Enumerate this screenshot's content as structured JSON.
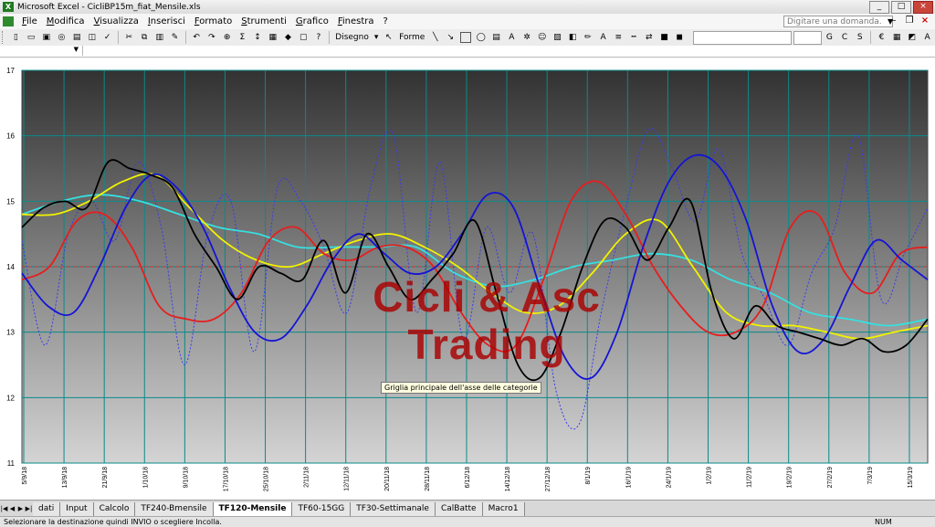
{
  "window": {
    "title": "Microsoft Excel - CicliBP15m_fiat_Mensile.xls"
  },
  "menu": [
    "File",
    "Modifica",
    "Visualizza",
    "Inserisci",
    "Formato",
    "Strumenti",
    "Grafico",
    "Finestra",
    "?"
  ],
  "help_box": {
    "placeholder": "Digitare una domanda."
  },
  "toolbar": {
    "drawing_label": "Disegno",
    "shapes_label": "Forme"
  },
  "watermark": {
    "line1": "Cicli & Asc",
    "line2": "Trading"
  },
  "tooltip": "Griglia principale dell'asse delle categorie",
  "sheet_tabs": [
    "dati",
    "Input",
    "Calcolo",
    "TF240-Bmensile",
    "TF120-Mensile",
    "TF60-15GG",
    "TF30-Settimanale",
    "CalBatte",
    "Macro1"
  ],
  "active_tab": "TF120-Mensile",
  "status": {
    "message": "Selezionare la destinazione quindi INVIO o scegliere Incolla.",
    "num": "NUM"
  },
  "colors": {
    "black": "#000000",
    "blue": "#1414d6",
    "red": "#e61e1e",
    "yellow": "#f2f200",
    "cyan": "#36e0e0",
    "dotted": "#3a3aee",
    "refline": "#d03030",
    "grid": "#0a8a8a"
  },
  "chart_data": {
    "type": "line",
    "ylim": [
      11,
      17
    ],
    "yticks": [
      11,
      12,
      13,
      14,
      15,
      16,
      17
    ],
    "reference_line": 14,
    "grid": true,
    "xticks": [
      "5/9/18",
      "13/9/18",
      "21/9/18",
      "1/10/18",
      "9/10/18",
      "17/10/18",
      "25/10/18",
      "2/11/18",
      "12/11/18",
      "20/11/18",
      "28/11/18",
      "6/12/18",
      "14/12/18",
      "27/12/18",
      "8/1/19",
      "16/1/19",
      "24/1/19",
      "1/2/19",
      "11/2/19",
      "19/2/19",
      "27/2/19",
      "7/3/19",
      "15/3/19"
    ],
    "series": [
      {
        "color": "#000000",
        "style": "solid",
        "values": [
          14.6,
          14.9,
          15.0,
          14.9,
          15.6,
          15.5,
          15.4,
          15.2,
          14.5,
          14.0,
          13.5,
          14.0,
          13.9,
          13.8,
          14.4,
          13.6,
          14.5,
          14.0,
          13.5,
          13.8,
          14.2,
          14.7,
          13.6,
          12.5,
          12.3,
          13.0,
          14.0,
          14.7,
          14.6,
          14.1,
          14.6,
          15.0,
          13.6,
          12.9,
          13.4,
          13.1,
          13.0,
          12.9,
          12.8,
          12.9,
          12.7,
          12.8,
          13.2
        ]
      },
      {
        "color": "#1414d6",
        "style": "solid",
        "values": [
          13.9,
          13.4,
          13.3,
          14.0,
          14.9,
          15.4,
          15.2,
          14.6,
          13.7,
          13.0,
          12.9,
          13.4,
          14.1,
          14.5,
          14.2,
          13.9,
          14.0,
          14.5,
          15.1,
          14.9,
          13.7,
          12.6,
          12.3,
          13.0,
          14.3,
          15.3,
          15.7,
          15.5,
          14.7,
          13.4,
          12.7,
          12.9,
          13.7,
          14.4,
          14.1,
          13.8
        ]
      },
      {
        "color": "#e61e1e",
        "style": "solid",
        "values": [
          13.8,
          14.0,
          14.7,
          14.8,
          14.3,
          13.4,
          13.2,
          13.2,
          13.6,
          14.4,
          14.6,
          14.2,
          14.1,
          14.3,
          14.3,
          14.0,
          13.3,
          12.8,
          12.8,
          13.8,
          15.0,
          15.3,
          14.8,
          14.0,
          13.4,
          13.0,
          13.0,
          13.4,
          14.6,
          14.8,
          13.9,
          13.6,
          14.2,
          14.3
        ]
      },
      {
        "color": "#f2f200",
        "style": "solid",
        "values": [
          14.8,
          14.8,
          15.0,
          15.3,
          15.4,
          14.9,
          14.4,
          14.1,
          14.0,
          14.2,
          14.4,
          14.5,
          14.3,
          14.0,
          13.6,
          13.3,
          13.4,
          13.9,
          14.5,
          14.7,
          14.0,
          13.3,
          13.1,
          13.1,
          13.0,
          12.9,
          13.0,
          13.1
        ]
      },
      {
        "color": "#36e0e0",
        "style": "solid",
        "values": [
          14.8,
          15.0,
          15.1,
          15.0,
          14.8,
          14.6,
          14.5,
          14.3,
          14.3,
          14.3,
          14.3,
          13.9,
          13.7,
          13.8,
          14.0,
          14.1,
          14.2,
          14.1,
          13.8,
          13.6,
          13.3,
          13.2,
          13.1,
          13.2
        ]
      },
      {
        "color": "#3a3aee",
        "style": "dotted",
        "values": [
          14.4,
          12.8,
          14.5,
          15.0,
          14.4,
          15.6,
          14.6,
          12.5,
          14.5,
          15.0,
          12.7,
          15.2,
          15.0,
          14.3,
          13.3,
          15.2,
          16.0,
          13.3,
          15.6,
          12.9,
          14.6,
          13.6,
          14.5,
          12.1,
          11.6,
          13.4,
          14.9,
          16.1,
          15.5,
          14.7,
          15.8,
          14.2,
          13.5,
          12.8,
          13.9,
          14.6,
          16.0,
          13.5,
          14.2,
          14.9
        ]
      }
    ]
  }
}
